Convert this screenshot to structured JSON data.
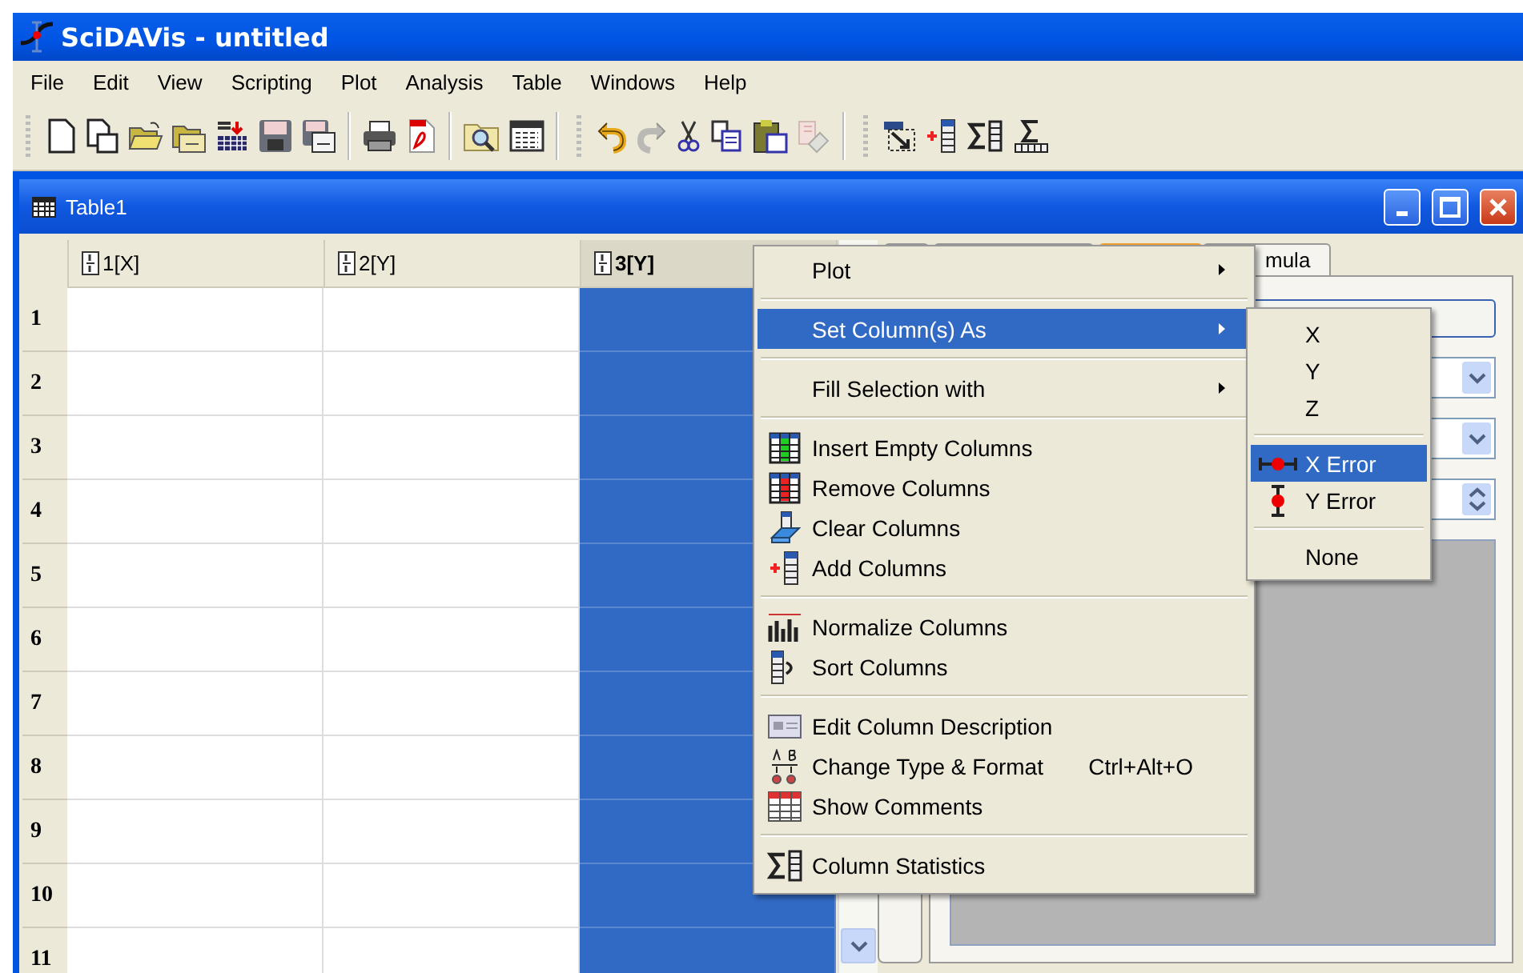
{
  "window": {
    "title": "SciDAVis - untitled"
  },
  "menu_bar": [
    "File",
    "Edit",
    "View",
    "Scripting",
    "Plot",
    "Analysis",
    "Table",
    "Windows",
    "Help"
  ],
  "toolbar": [
    {
      "grip": true,
      "items": [
        {
          "kind": "document",
          "disabled": false
        },
        {
          "kind": "document-copy",
          "disabled": false
        },
        {
          "kind": "folder",
          "disabled": false
        },
        {
          "kind": "folder-stack",
          "disabled": false
        },
        {
          "kind": "number-grid",
          "disabled": false
        },
        {
          "kind": "floppy-disk",
          "disabled": false
        },
        {
          "kind": "floppy-disks",
          "disabled": false
        }
      ]
    },
    {
      "grip": false,
      "items": [
        {
          "kind": "printer",
          "disabled": false
        },
        {
          "kind": "red-document",
          "disabled": false
        }
      ]
    },
    {
      "grip": false,
      "items": [
        {
          "kind": "magnifier-folder",
          "disabled": false
        },
        {
          "kind": "table",
          "disabled": false
        }
      ]
    },
    {
      "grip": true,
      "items": [
        {
          "kind": "undo",
          "disabled": false
        },
        {
          "kind": "redo",
          "disabled": true
        },
        {
          "kind": "cut",
          "disabled": false
        },
        {
          "kind": "copy",
          "disabled": false
        },
        {
          "kind": "paste",
          "disabled": false
        },
        {
          "kind": "eraser",
          "disabled": true
        }
      ]
    },
    {
      "grip": true,
      "items": [
        {
          "kind": "selection",
          "disabled": false
        },
        {
          "kind": "add-column",
          "disabled": false
        },
        {
          "kind": "sigma-column",
          "disabled": false
        },
        {
          "kind": "sigma-row",
          "disabled": false
        }
      ]
    }
  ],
  "table_window": {
    "title": "Table1",
    "columns": [
      {
        "label": "1[X]",
        "selected": false
      },
      {
        "label": "2[Y]",
        "selected": false
      },
      {
        "label": "3[Y]",
        "selected": true
      }
    ],
    "rows": [
      "1",
      "2",
      "3",
      "4",
      "5",
      "6",
      "7",
      "8",
      "9",
      "10",
      "11"
    ]
  },
  "side_panel": {
    "tabs": [
      {
        "selected": false
      },
      {
        "selected": false
      },
      {
        "selected": true
      },
      {
        "label": "mula",
        "selected": false
      }
    ]
  },
  "context_menu": [
    [
      {
        "label": "Plot",
        "submenu": true,
        "selected": false
      }
    ],
    [
      {
        "label": "Set Column(s) As",
        "submenu": true,
        "selected": true
      }
    ],
    [
      {
        "label": "Fill Selection with",
        "submenu": true,
        "selected": false
      }
    ],
    [
      {
        "label": "Insert Empty Columns",
        "kind": "insert",
        "selected": false
      },
      {
        "label": "Remove Columns",
        "kind": "remove",
        "selected": false
      },
      {
        "label": "Clear Columns",
        "kind": "clear",
        "selected": false
      },
      {
        "label": "Add Columns",
        "kind": "add",
        "selected": false
      }
    ],
    [
      {
        "label": "Normalize Columns",
        "kind": "normalize",
        "selected": false
      },
      {
        "label": "Sort Columns",
        "kind": "sort",
        "selected": false
      }
    ],
    [
      {
        "label": "Edit Column Description",
        "kind": "description",
        "selected": false
      },
      {
        "label": "Change Type & Format",
        "kind": "format",
        "shortcut": "Ctrl+Alt+O",
        "selected": false
      },
      {
        "label": "Show Comments",
        "kind": "comments",
        "selected": false
      }
    ],
    [
      {
        "label": "Column Statistics",
        "kind": "statistics",
        "selected": false
      }
    ]
  ],
  "submenu": [
    [
      {
        "label": "X",
        "selected": false
      },
      {
        "label": "Y",
        "selected": false
      },
      {
        "label": "Z",
        "selected": false
      }
    ],
    [
      {
        "label": "X Error",
        "kind": "x-error",
        "selected": true
      },
      {
        "label": "Y Error",
        "kind": "y-error",
        "selected": false
      }
    ],
    [
      {
        "label": "None",
        "selected": false
      }
    ]
  ]
}
